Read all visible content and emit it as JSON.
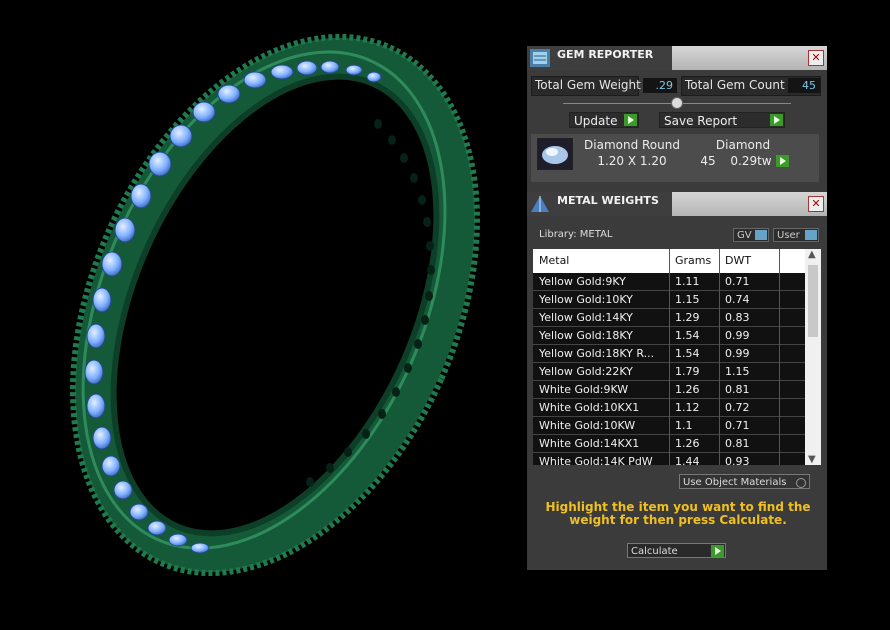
{
  "gem_reporter": {
    "title": "GEM REPORTER",
    "close": "✕",
    "total_weight_label": "Total Gem Weight",
    "total_weight_value": ".29",
    "total_count_label": "Total Gem Count",
    "total_count_value": "45",
    "update_label": "Update",
    "save_report_label": "Save Report",
    "gem": {
      "name": "Diamond Round",
      "size": "1.20 X 1.20",
      "material": "Diamond",
      "count": "45",
      "weight": "0.29tw"
    }
  },
  "metal_weights": {
    "title": "METAL WEIGHTS",
    "close": "✕",
    "library_label": "Library: METAL",
    "gv_label": "GV",
    "user_label": "User",
    "columns": [
      "Metal",
      "Grams",
      "DWT"
    ],
    "rows": [
      [
        "Yellow Gold:9KY",
        "1.11",
        "0.71"
      ],
      [
        "Yellow Gold:10KY",
        "1.15",
        "0.74"
      ],
      [
        "Yellow Gold:14KY",
        "1.29",
        "0.83"
      ],
      [
        "Yellow Gold:18KY",
        "1.54",
        "0.99"
      ],
      [
        "Yellow Gold:18KY R...",
        "1.54",
        "0.99"
      ],
      [
        "Yellow Gold:22KY",
        "1.79",
        "1.15"
      ],
      [
        "White Gold:9KW",
        "1.26",
        "0.81"
      ],
      [
        "White Gold:10KX1",
        "1.12",
        "0.72"
      ],
      [
        "White Gold:10KW",
        "1.1",
        "0.71"
      ],
      [
        "White Gold:14KX1",
        "1.26",
        "0.81"
      ],
      [
        "White Gold:14K PdW",
        "1.44",
        "0.93"
      ]
    ],
    "use_object_materials": "Use Object Materials",
    "hint": "Highlight the item you want to find the weight for then press Calculate.",
    "calculate_label": "Calculate"
  },
  "colors": {
    "ring": "#1e6b45",
    "gems": "#7fb0ff",
    "hint": "#f0c020",
    "play": "#3b9a2a"
  }
}
